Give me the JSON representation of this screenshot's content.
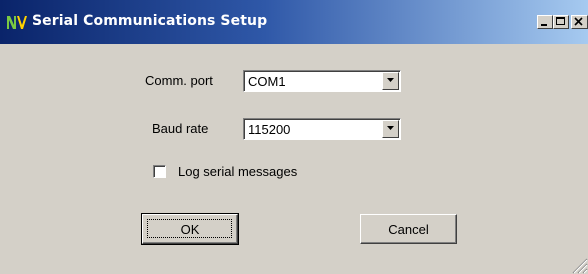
{
  "window": {
    "title": "Serial Communications Setup",
    "icon": "nv-app-icon",
    "controls": [
      "minimize-icon",
      "maximize-icon",
      "close-icon"
    ]
  },
  "form": {
    "comm_port_label": "Comm. port",
    "comm_port_value": "COM1",
    "baud_rate_label": "Baud rate",
    "baud_rate_value": "115200",
    "log_label": "Log serial messages",
    "log_checked": false
  },
  "buttons": {
    "ok": "OK",
    "cancel": "Cancel"
  },
  "colors": {
    "titlebar_start": "#0a246a",
    "titlebar_end": "#a6caf0",
    "face": "#d4d0c8"
  }
}
